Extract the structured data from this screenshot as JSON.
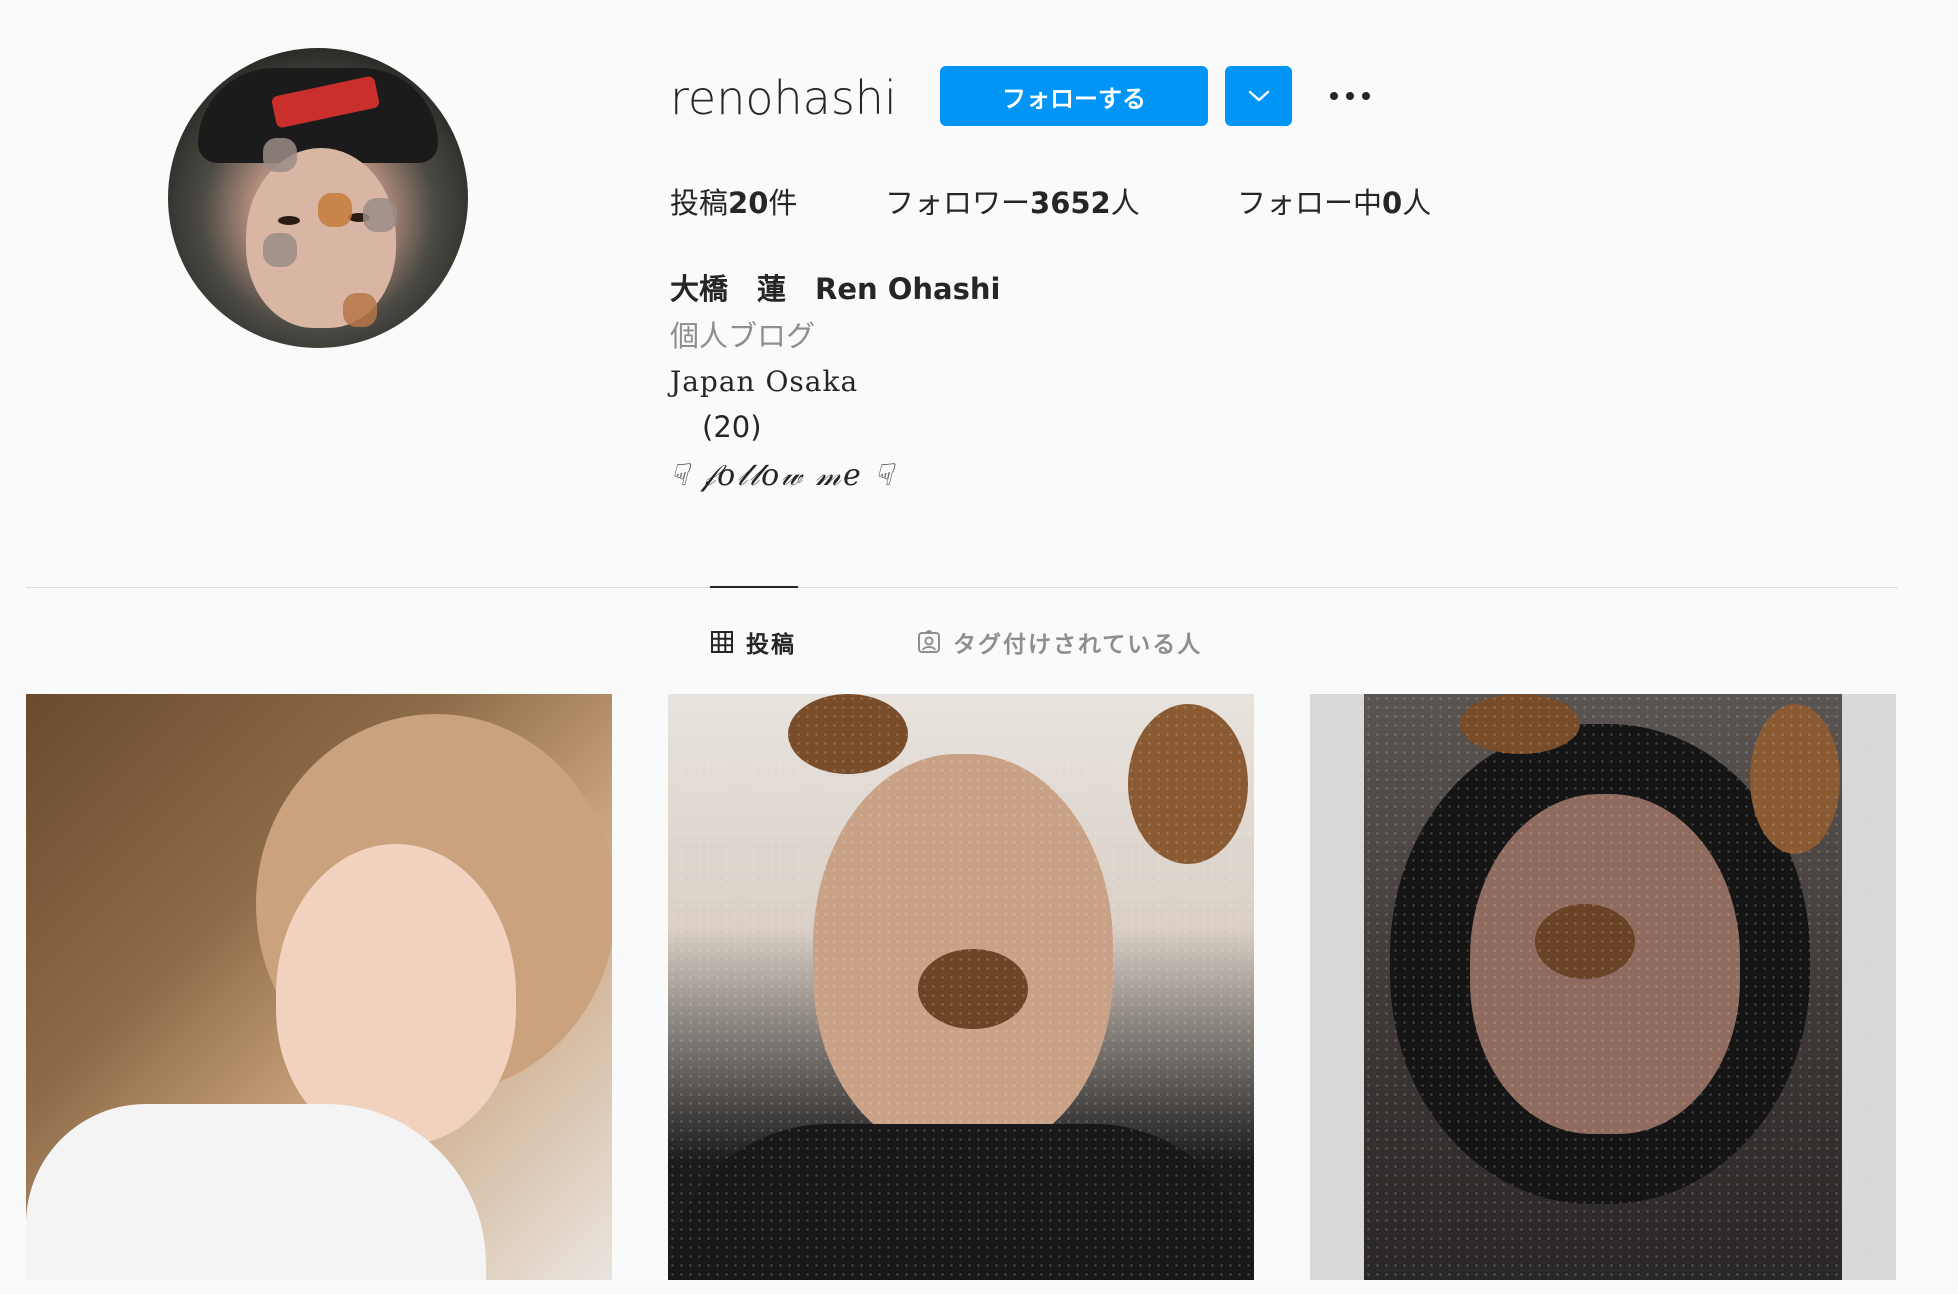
{
  "profile": {
    "username": "renohashi",
    "follow_label": "フォローする",
    "stats": {
      "posts_prefix": "投稿",
      "posts_count": "20",
      "posts_suffix": "件",
      "followers_prefix": "フォロワー",
      "followers_count": "3652",
      "followers_suffix": "人",
      "following_prefix": "フォロー中",
      "following_count": "0",
      "following_suffix": "人"
    },
    "full_name": "大橋　蓮　Ren Ohashi",
    "category": "個人ブログ",
    "bio_lines": [
      "Japan Osaka",
      "(20)",
      "☟ 𝒻𝑜𝓁𝓁𝑜𝓌 𝓂𝑒 ☟"
    ]
  },
  "tabs": {
    "posts_label": "投稿",
    "tagged_label": "タグ付けされている人",
    "active": "posts"
  },
  "colors": {
    "accent": "#0095f6",
    "background": "#fafafa",
    "text": "#262626",
    "muted": "#8e8e8e"
  },
  "icons": {
    "dropdown": "chevron-down-icon",
    "more": "more-horizontal-icon",
    "posts_tab": "grid-icon",
    "tagged_tab": "tagged-person-icon"
  },
  "posts": [
    {
      "description": "selfie"
    },
    {
      "description": "selfie"
    },
    {
      "description": "selfie"
    }
  ]
}
